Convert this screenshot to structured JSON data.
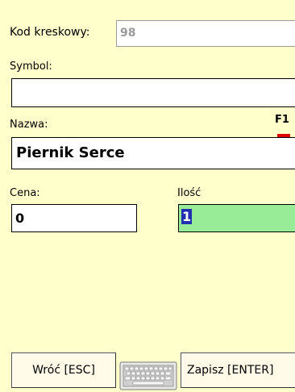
{
  "form": {
    "barcode": {
      "label": "Kod kreskowy:",
      "value": "98"
    },
    "symbol": {
      "label": "Symbol:",
      "value": ""
    },
    "name": {
      "label": "Nazwa:",
      "value": "Piernik Serce",
      "hotkey": "F1"
    },
    "price": {
      "label": "Cena:",
      "value": "0"
    },
    "quantity": {
      "label": "Ilość",
      "value": "1"
    }
  },
  "buttons": {
    "back_label": "Wróć [ESC]",
    "save_label": "Zapisz  [ENTER]"
  },
  "icons": {
    "keyboard": "keyboard-icon"
  },
  "colors": {
    "background": "#ffffcc",
    "quantity_field": "#98ec98",
    "selection": "#2030b0",
    "hotkey_marker": "#e00000"
  }
}
